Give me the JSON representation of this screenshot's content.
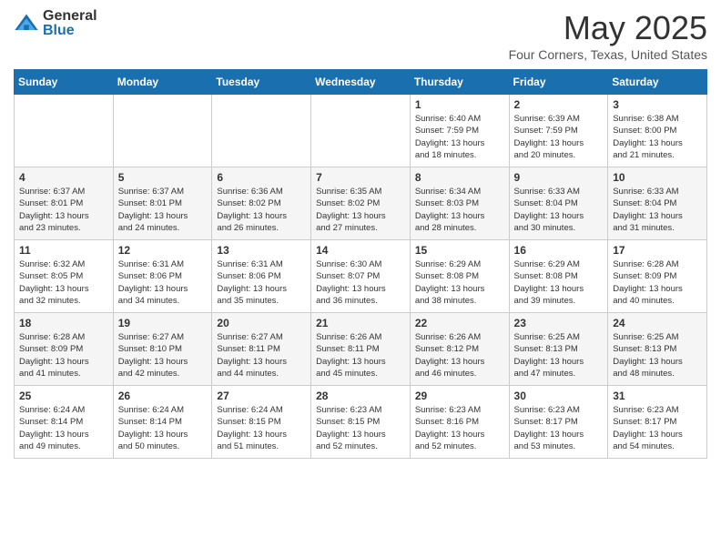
{
  "header": {
    "logo_general": "General",
    "logo_blue": "Blue",
    "title": "May 2025",
    "subtitle": "Four Corners, Texas, United States"
  },
  "days_of_week": [
    "Sunday",
    "Monday",
    "Tuesday",
    "Wednesday",
    "Thursday",
    "Friday",
    "Saturday"
  ],
  "weeks": [
    [
      {
        "day": "",
        "info": ""
      },
      {
        "day": "",
        "info": ""
      },
      {
        "day": "",
        "info": ""
      },
      {
        "day": "",
        "info": ""
      },
      {
        "day": "1",
        "info": "Sunrise: 6:40 AM\nSunset: 7:59 PM\nDaylight: 13 hours\nand 18 minutes."
      },
      {
        "day": "2",
        "info": "Sunrise: 6:39 AM\nSunset: 7:59 PM\nDaylight: 13 hours\nand 20 minutes."
      },
      {
        "day": "3",
        "info": "Sunrise: 6:38 AM\nSunset: 8:00 PM\nDaylight: 13 hours\nand 21 minutes."
      }
    ],
    [
      {
        "day": "4",
        "info": "Sunrise: 6:37 AM\nSunset: 8:01 PM\nDaylight: 13 hours\nand 23 minutes."
      },
      {
        "day": "5",
        "info": "Sunrise: 6:37 AM\nSunset: 8:01 PM\nDaylight: 13 hours\nand 24 minutes."
      },
      {
        "day": "6",
        "info": "Sunrise: 6:36 AM\nSunset: 8:02 PM\nDaylight: 13 hours\nand 26 minutes."
      },
      {
        "day": "7",
        "info": "Sunrise: 6:35 AM\nSunset: 8:02 PM\nDaylight: 13 hours\nand 27 minutes."
      },
      {
        "day": "8",
        "info": "Sunrise: 6:34 AM\nSunset: 8:03 PM\nDaylight: 13 hours\nand 28 minutes."
      },
      {
        "day": "9",
        "info": "Sunrise: 6:33 AM\nSunset: 8:04 PM\nDaylight: 13 hours\nand 30 minutes."
      },
      {
        "day": "10",
        "info": "Sunrise: 6:33 AM\nSunset: 8:04 PM\nDaylight: 13 hours\nand 31 minutes."
      }
    ],
    [
      {
        "day": "11",
        "info": "Sunrise: 6:32 AM\nSunset: 8:05 PM\nDaylight: 13 hours\nand 32 minutes."
      },
      {
        "day": "12",
        "info": "Sunrise: 6:31 AM\nSunset: 8:06 PM\nDaylight: 13 hours\nand 34 minutes."
      },
      {
        "day": "13",
        "info": "Sunrise: 6:31 AM\nSunset: 8:06 PM\nDaylight: 13 hours\nand 35 minutes."
      },
      {
        "day": "14",
        "info": "Sunrise: 6:30 AM\nSunset: 8:07 PM\nDaylight: 13 hours\nand 36 minutes."
      },
      {
        "day": "15",
        "info": "Sunrise: 6:29 AM\nSunset: 8:08 PM\nDaylight: 13 hours\nand 38 minutes."
      },
      {
        "day": "16",
        "info": "Sunrise: 6:29 AM\nSunset: 8:08 PM\nDaylight: 13 hours\nand 39 minutes."
      },
      {
        "day": "17",
        "info": "Sunrise: 6:28 AM\nSunset: 8:09 PM\nDaylight: 13 hours\nand 40 minutes."
      }
    ],
    [
      {
        "day": "18",
        "info": "Sunrise: 6:28 AM\nSunset: 8:09 PM\nDaylight: 13 hours\nand 41 minutes."
      },
      {
        "day": "19",
        "info": "Sunrise: 6:27 AM\nSunset: 8:10 PM\nDaylight: 13 hours\nand 42 minutes."
      },
      {
        "day": "20",
        "info": "Sunrise: 6:27 AM\nSunset: 8:11 PM\nDaylight: 13 hours\nand 44 minutes."
      },
      {
        "day": "21",
        "info": "Sunrise: 6:26 AM\nSunset: 8:11 PM\nDaylight: 13 hours\nand 45 minutes."
      },
      {
        "day": "22",
        "info": "Sunrise: 6:26 AM\nSunset: 8:12 PM\nDaylight: 13 hours\nand 46 minutes."
      },
      {
        "day": "23",
        "info": "Sunrise: 6:25 AM\nSunset: 8:13 PM\nDaylight: 13 hours\nand 47 minutes."
      },
      {
        "day": "24",
        "info": "Sunrise: 6:25 AM\nSunset: 8:13 PM\nDaylight: 13 hours\nand 48 minutes."
      }
    ],
    [
      {
        "day": "25",
        "info": "Sunrise: 6:24 AM\nSunset: 8:14 PM\nDaylight: 13 hours\nand 49 minutes."
      },
      {
        "day": "26",
        "info": "Sunrise: 6:24 AM\nSunset: 8:14 PM\nDaylight: 13 hours\nand 50 minutes."
      },
      {
        "day": "27",
        "info": "Sunrise: 6:24 AM\nSunset: 8:15 PM\nDaylight: 13 hours\nand 51 minutes."
      },
      {
        "day": "28",
        "info": "Sunrise: 6:23 AM\nSunset: 8:15 PM\nDaylight: 13 hours\nand 52 minutes."
      },
      {
        "day": "29",
        "info": "Sunrise: 6:23 AM\nSunset: 8:16 PM\nDaylight: 13 hours\nand 52 minutes."
      },
      {
        "day": "30",
        "info": "Sunrise: 6:23 AM\nSunset: 8:17 PM\nDaylight: 13 hours\nand 53 minutes."
      },
      {
        "day": "31",
        "info": "Sunrise: 6:23 AM\nSunset: 8:17 PM\nDaylight: 13 hours\nand 54 minutes."
      }
    ]
  ]
}
